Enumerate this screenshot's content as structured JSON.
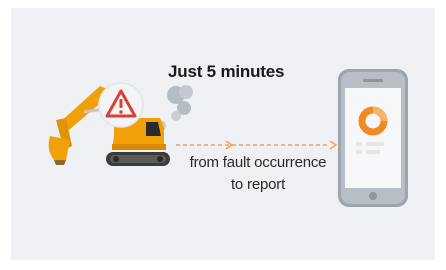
{
  "headline": "Just 5 minutes",
  "caption": {
    "line1": "from fault occurrence",
    "line2": "to report"
  },
  "icons": {
    "machine": "excavator-icon",
    "alert": "warning-triangle-icon",
    "exhaust": "smoke-icon",
    "device": "smartphone-icon",
    "chart": "donut-chart-icon"
  },
  "colors": {
    "panel": "#eef0f3",
    "excavator": "#f2a007",
    "alert": "#d9403a",
    "arrow": "#f6a25a",
    "phone_frame": "#9ca4ac",
    "donut": "#f08a22"
  }
}
